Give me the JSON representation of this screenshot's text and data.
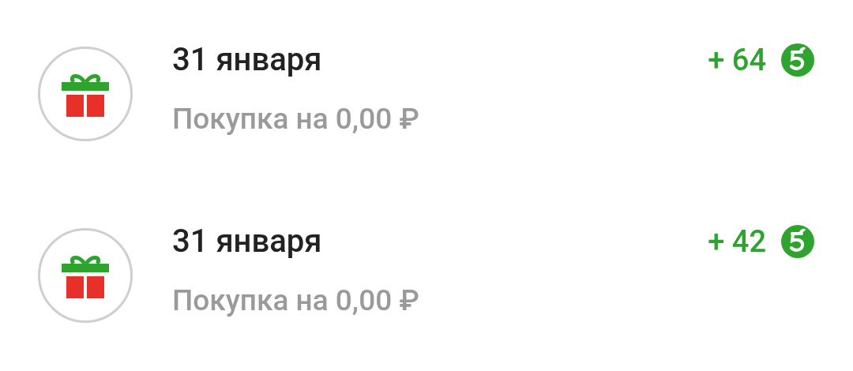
{
  "transactions": [
    {
      "date": "31 января",
      "description": "Покупка на 0,00 ₽",
      "points": "+ 64"
    },
    {
      "date": "31 января",
      "description": "Покупка на 0,00 ₽",
      "points": "+ 42"
    }
  ]
}
